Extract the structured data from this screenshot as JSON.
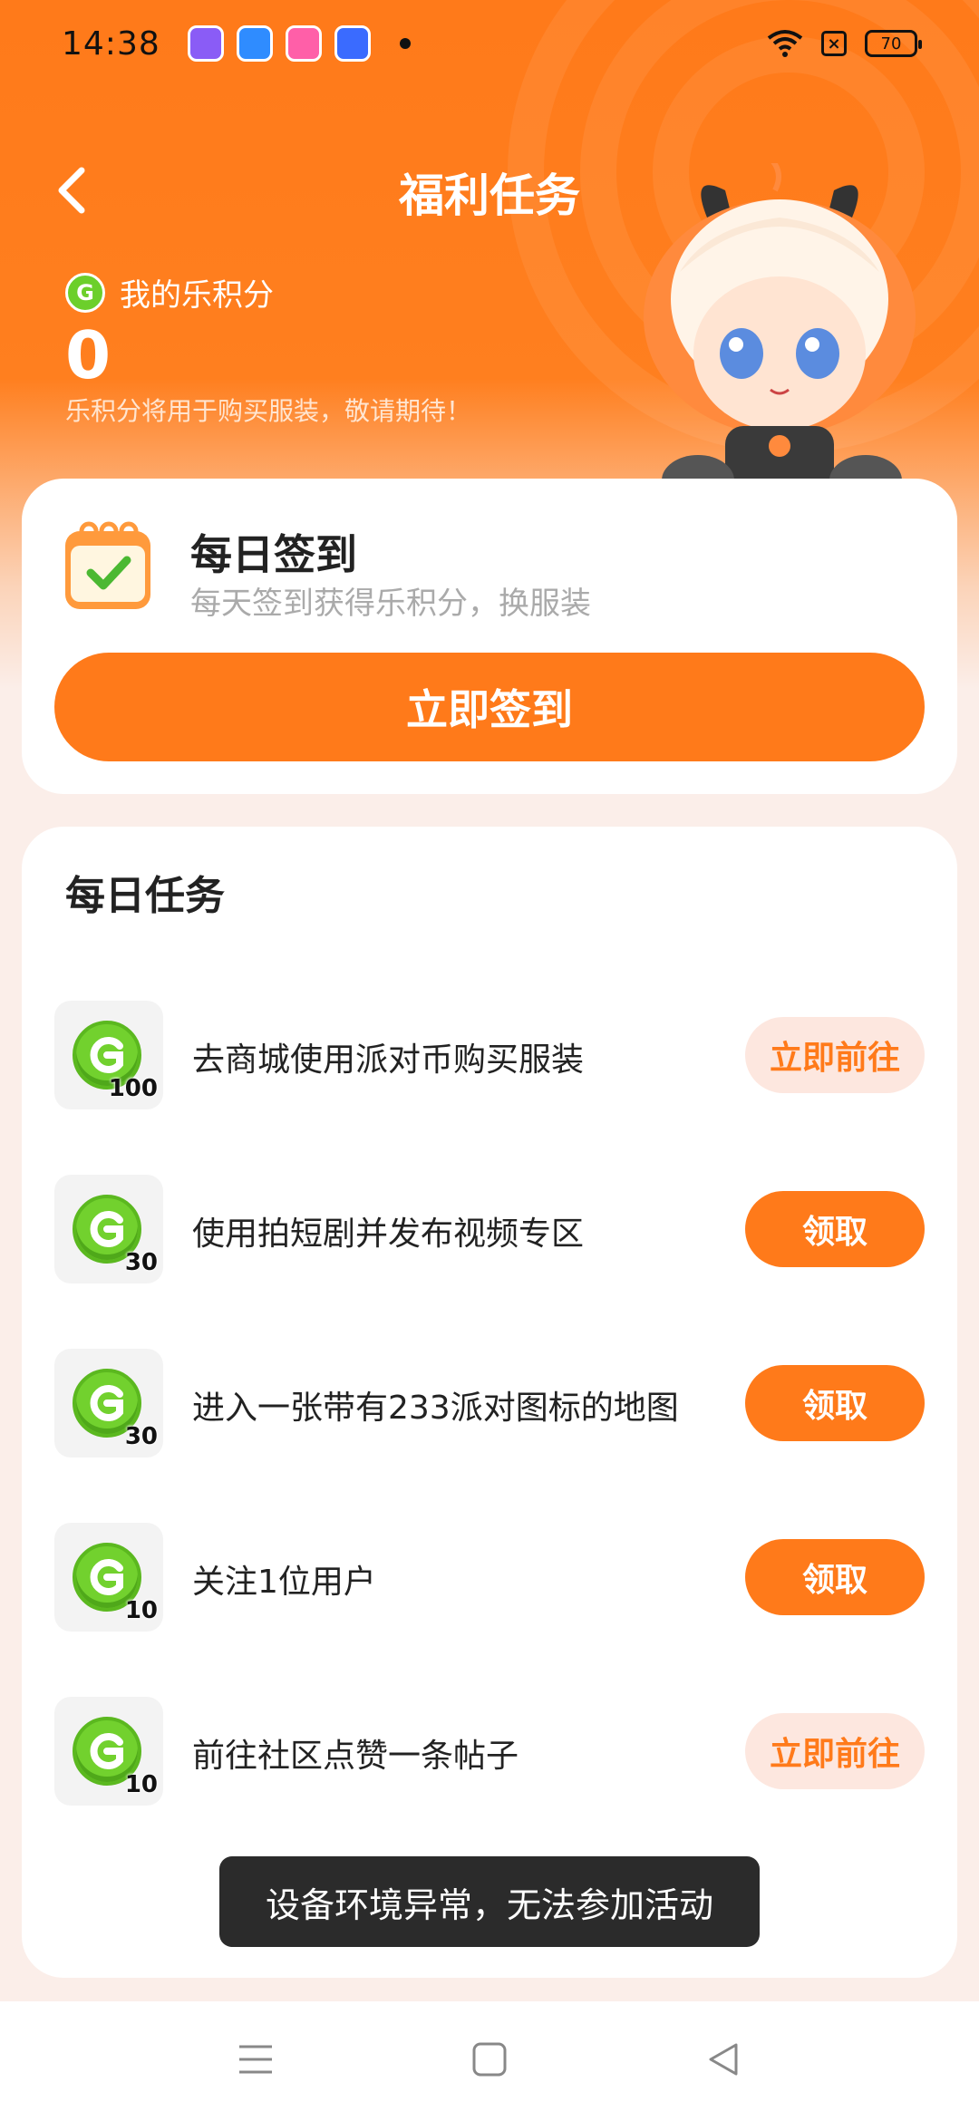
{
  "status_bar": {
    "time": "14:38",
    "battery": "70"
  },
  "header": {
    "title": "福利任务"
  },
  "points": {
    "label": "我的乐积分",
    "value": "0",
    "note": "乐积分将用于购买服装，敬请期待！"
  },
  "checkin": {
    "title": "每日签到",
    "subtitle": "每天签到获得乐积分，换服装",
    "button_label": "立即签到"
  },
  "daily_tasks": {
    "title": "每日任务",
    "items": [
      {
        "reward": "100",
        "text": "去商城使用派对币购买服装",
        "button": "立即前往",
        "button_type": "go"
      },
      {
        "reward": "30",
        "text": "使用拍短剧并发布视频专区",
        "button": "领取",
        "button_type": "claim"
      },
      {
        "reward": "30",
        "text": "进入一张带有233派对图标的地图",
        "button": "领取",
        "button_type": "claim"
      },
      {
        "reward": "10",
        "text": "关注1位用户",
        "button": "领取",
        "button_type": "claim"
      },
      {
        "reward": "10",
        "text": "前往社区点赞一条帖子",
        "button": "立即前往",
        "button_type": "go"
      }
    ]
  },
  "toast": {
    "text": "设备环境异常，无法参加活动"
  },
  "colors": {
    "accent": "#ff7a1a",
    "coin": "#72d12e",
    "go_bg": "#fde7df"
  }
}
